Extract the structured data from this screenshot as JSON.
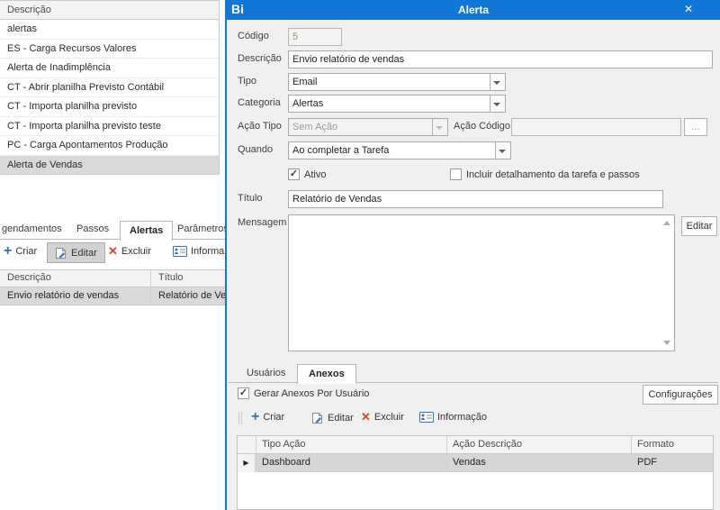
{
  "background_window": {
    "list": {
      "header": "Descrição",
      "rows": [
        "alertas",
        "ES - Carga Recursos Valores",
        "Alerta de Inadimplência",
        "CT - Abrir planilha Previsto Contábil",
        "CT - Importa planilha previsto",
        "CT - Importa planilha previsto teste",
        "PC - Carga Apontamentos Produção",
        "Alerta de Vendas"
      ],
      "selected_row": "Alerta de Vendas"
    },
    "tabs": [
      "gendamentos",
      "Passos",
      "Alertas",
      "Parâmetros"
    ],
    "active_tab": "Alertas",
    "toolbar": {
      "criar": "Criar",
      "editar": "Editar",
      "excluir": "Excluir",
      "informacao": "Informa"
    },
    "table": {
      "columns": [
        "Descrição",
        "Título"
      ],
      "rows": [
        [
          "Envio relatório de vendas",
          "Relatório de Vend"
        ]
      ]
    }
  },
  "dialog": {
    "logo": "Bi",
    "title": "Alerta",
    "fields": {
      "codigo": {
        "label": "Código",
        "value": "5"
      },
      "descricao": {
        "label": "Descrição",
        "value": "Envio relatório de vendas"
      },
      "tipo": {
        "label": "Tipo",
        "value": "Email"
      },
      "categoria": {
        "label": "Categoria",
        "value": "Alertas"
      },
      "acao_tipo": {
        "label": "Ação Tipo",
        "value": "Sem Ação"
      },
      "acao_codigo": {
        "label": "Ação Código",
        "value": "",
        "browse": "..."
      },
      "quando": {
        "label": "Quando",
        "value": "Ao completar a Tarefa"
      },
      "ativo": {
        "label": "Ativo",
        "checked": true
      },
      "incluir": {
        "label": "Incluir detalhamento da tarefa e passos",
        "checked": false
      },
      "titulo": {
        "label": "Título",
        "value": "Relatório de Vendas"
      },
      "mensagem": {
        "label": "Mensagem",
        "value": "",
        "editar_button": "Editar"
      }
    },
    "tabs": {
      "usuarios": "Usuários",
      "anexos": "Anexos",
      "active": "Anexos"
    },
    "anexos_panel": {
      "gerar_checkbox": "Gerar Anexos Por Usuário",
      "configuracoes_button": "Configurações",
      "toolbar": {
        "criar": "Criar",
        "editar": "Editar",
        "excluir": "Excluir",
        "informacao": "Informação"
      },
      "table": {
        "columns": [
          "Tipo Ação",
          "Ação Descrição",
          "Formato"
        ],
        "rows": [
          [
            "Dashboard",
            "Vendas",
            "PDF"
          ]
        ]
      }
    }
  },
  "icons": {
    "plus": "+",
    "delete_x": "✕",
    "close": "✕",
    "check": "✓",
    "row_pointer": "▶"
  },
  "colors": {
    "titlebar_blue": "#1177d7",
    "selection_gray": "#d8d8d8",
    "icon_blue": "#3272c2",
    "icon_red": "#d8432f"
  }
}
